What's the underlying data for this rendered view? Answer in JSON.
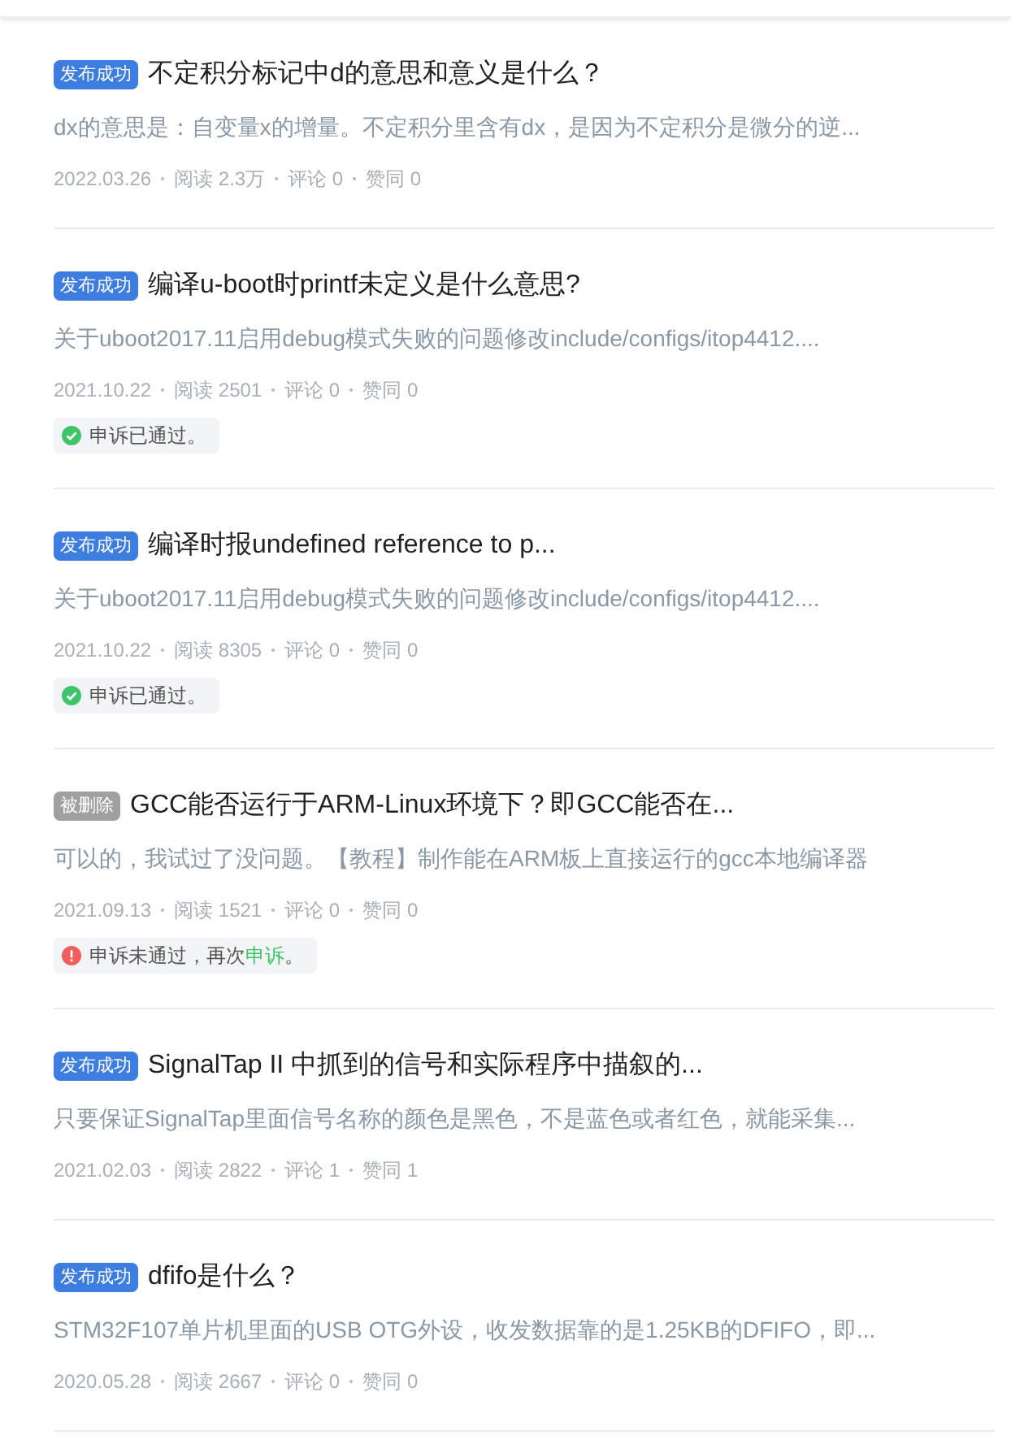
{
  "items": [
    {
      "badge": {
        "kind": "published",
        "label": "发布成功"
      },
      "title": "不定积分标记中d的意思和意义是什么？",
      "excerpt": "dx的意思是：自变量x的增量。不定积分里含有dx，是因为不定积分是微分的逆...",
      "meta": [
        "2022.03.26",
        "阅读 2.3万",
        "评论 0",
        "赞同 0"
      ]
    },
    {
      "badge": {
        "kind": "published",
        "label": "发布成功"
      },
      "title": "编译u-boot时printf未定义是什么意思?",
      "excerpt": "关于uboot2017.11启用debug模式失败的问题修改include/configs/itop4412....",
      "meta": [
        "2021.10.22",
        "阅读 2501",
        "评论 0",
        "赞同 0"
      ],
      "appeal": {
        "kind": "passed",
        "text": "申诉已通过。"
      }
    },
    {
      "badge": {
        "kind": "published",
        "label": "发布成功"
      },
      "title": "编译时报undefined reference to p...",
      "excerpt": "关于uboot2017.11启用debug模式失败的问题修改include/configs/itop4412....",
      "meta": [
        "2021.10.22",
        "阅读 8305",
        "评论 0",
        "赞同 0"
      ],
      "appeal": {
        "kind": "passed",
        "text": "申诉已通过。"
      }
    },
    {
      "badge": {
        "kind": "deleted",
        "label": "被删除"
      },
      "title": "GCC能否运行于ARM-Linux环境下？即GCC能否在...",
      "excerpt": "可以的，我试过了没问题。【教程】制作能在ARM板上直接运行的gcc本地编译器",
      "meta": [
        "2021.09.13",
        "阅读 1521",
        "评论 0",
        "赞同 0"
      ],
      "appeal": {
        "kind": "failed",
        "text": "申诉未通过，再次",
        "link": "申诉",
        "suffix": "。"
      }
    },
    {
      "badge": {
        "kind": "published",
        "label": "发布成功"
      },
      "title": "SignalTap II 中抓到的信号和实际程序中描叙的...",
      "excerpt": "只要保证SignalTap里面信号名称的颜色是黑色，不是蓝色或者红色，就能采集...",
      "meta": [
        "2021.02.03",
        "阅读 2822",
        "评论 1",
        "赞同 1"
      ]
    },
    {
      "badge": {
        "kind": "published",
        "label": "发布成功"
      },
      "title": "dfifo是什么？",
      "excerpt": "STM32F107单片机里面的USB OTG外设，收发数据靠的是1.25KB的DFIFO，即...",
      "meta": [
        "2020.05.28",
        "阅读 2667",
        "评论 0",
        "赞同 0"
      ]
    }
  ]
}
